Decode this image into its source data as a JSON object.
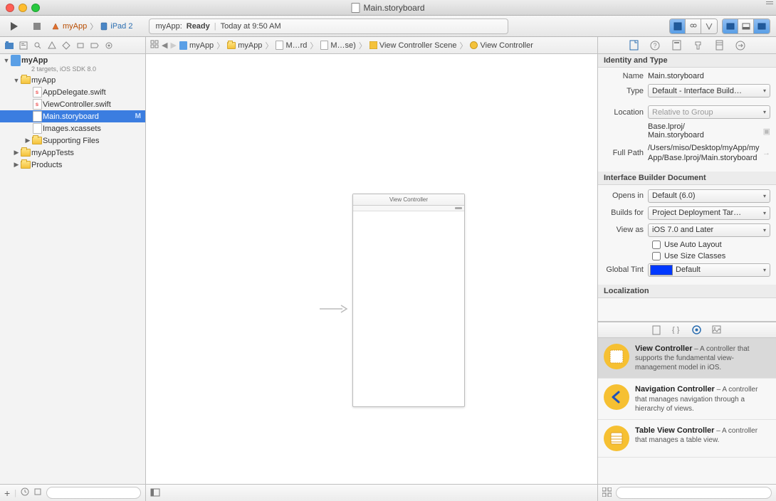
{
  "titlebar": {
    "document": "Main.storyboard"
  },
  "toolbar": {
    "scheme_app": "myApp",
    "scheme_device": "iPad 2",
    "status_app": "myApp:",
    "status_state": "Ready",
    "status_time": "Today at 9:50 AM"
  },
  "breadcrumbs": [
    {
      "icon": "project",
      "label": "myApp"
    },
    {
      "icon": "folder",
      "label": "myApp"
    },
    {
      "icon": "storyboard",
      "label": "M…rd"
    },
    {
      "icon": "storyboard",
      "label": "M…se)"
    },
    {
      "icon": "scene",
      "label": "View Controller Scene"
    },
    {
      "icon": "vc",
      "label": "View Controller"
    }
  ],
  "navigator": {
    "project": {
      "name": "myApp",
      "subtitle": "2 targets, iOS SDK 8.0"
    },
    "tree": [
      {
        "depth": 1,
        "icon": "folder",
        "label": "myApp",
        "disclosure": "open"
      },
      {
        "depth": 2,
        "icon": "swift",
        "label": "AppDelegate.swift"
      },
      {
        "depth": 2,
        "icon": "swift",
        "label": "ViewController.swift"
      },
      {
        "depth": 2,
        "icon": "storyboard",
        "label": "Main.storyboard",
        "badge": "M",
        "selected": true
      },
      {
        "depth": 2,
        "icon": "assets",
        "label": "Images.xcassets"
      },
      {
        "depth": 2,
        "icon": "folder",
        "label": "Supporting Files",
        "disclosure": "closed"
      },
      {
        "depth": 1,
        "icon": "folder",
        "label": "myAppTests",
        "disclosure": "closed"
      },
      {
        "depth": 1,
        "icon": "folder",
        "label": "Products",
        "disclosure": "closed"
      }
    ]
  },
  "canvas": {
    "scene_title": "View Controller"
  },
  "inspector": {
    "identity": {
      "header": "Identity and Type",
      "name_label": "Name",
      "name_value": "Main.storyboard",
      "type_label": "Type",
      "type_value": "Default - Interface Build…",
      "location_label": "Location",
      "location_value": "Relative to Group",
      "location_path1": "Base.lproj/",
      "location_path2": "Main.storyboard",
      "fullpath_label": "Full Path",
      "fullpath_value": "/Users/miso/Desktop/myApp/myApp/Base.lproj/Main.storyboard"
    },
    "ibdoc": {
      "header": "Interface Builder Document",
      "opens_label": "Opens in",
      "opens_value": "Default (6.0)",
      "builds_label": "Builds for",
      "builds_value": "Project Deployment Tar…",
      "viewas_label": "View as",
      "viewas_value": "iOS 7.0 and Later",
      "autolayout_label": "Use Auto Layout",
      "sizeclass_label": "Use Size Classes",
      "tint_label": "Global Tint",
      "tint_value": "Default"
    },
    "localization_header": "Localization"
  },
  "library": [
    {
      "title": "View Controller",
      "desc": " – A controller that supports the fundamental view-management model in iOS.",
      "icon": "vc",
      "selected": true
    },
    {
      "title": "Navigation Controller",
      "desc": " – A controller that manages navigation through a hierarchy of views.",
      "icon": "nav"
    },
    {
      "title": "Table View Controller",
      "desc": " – A controller that manages a table view.",
      "icon": "table"
    }
  ]
}
